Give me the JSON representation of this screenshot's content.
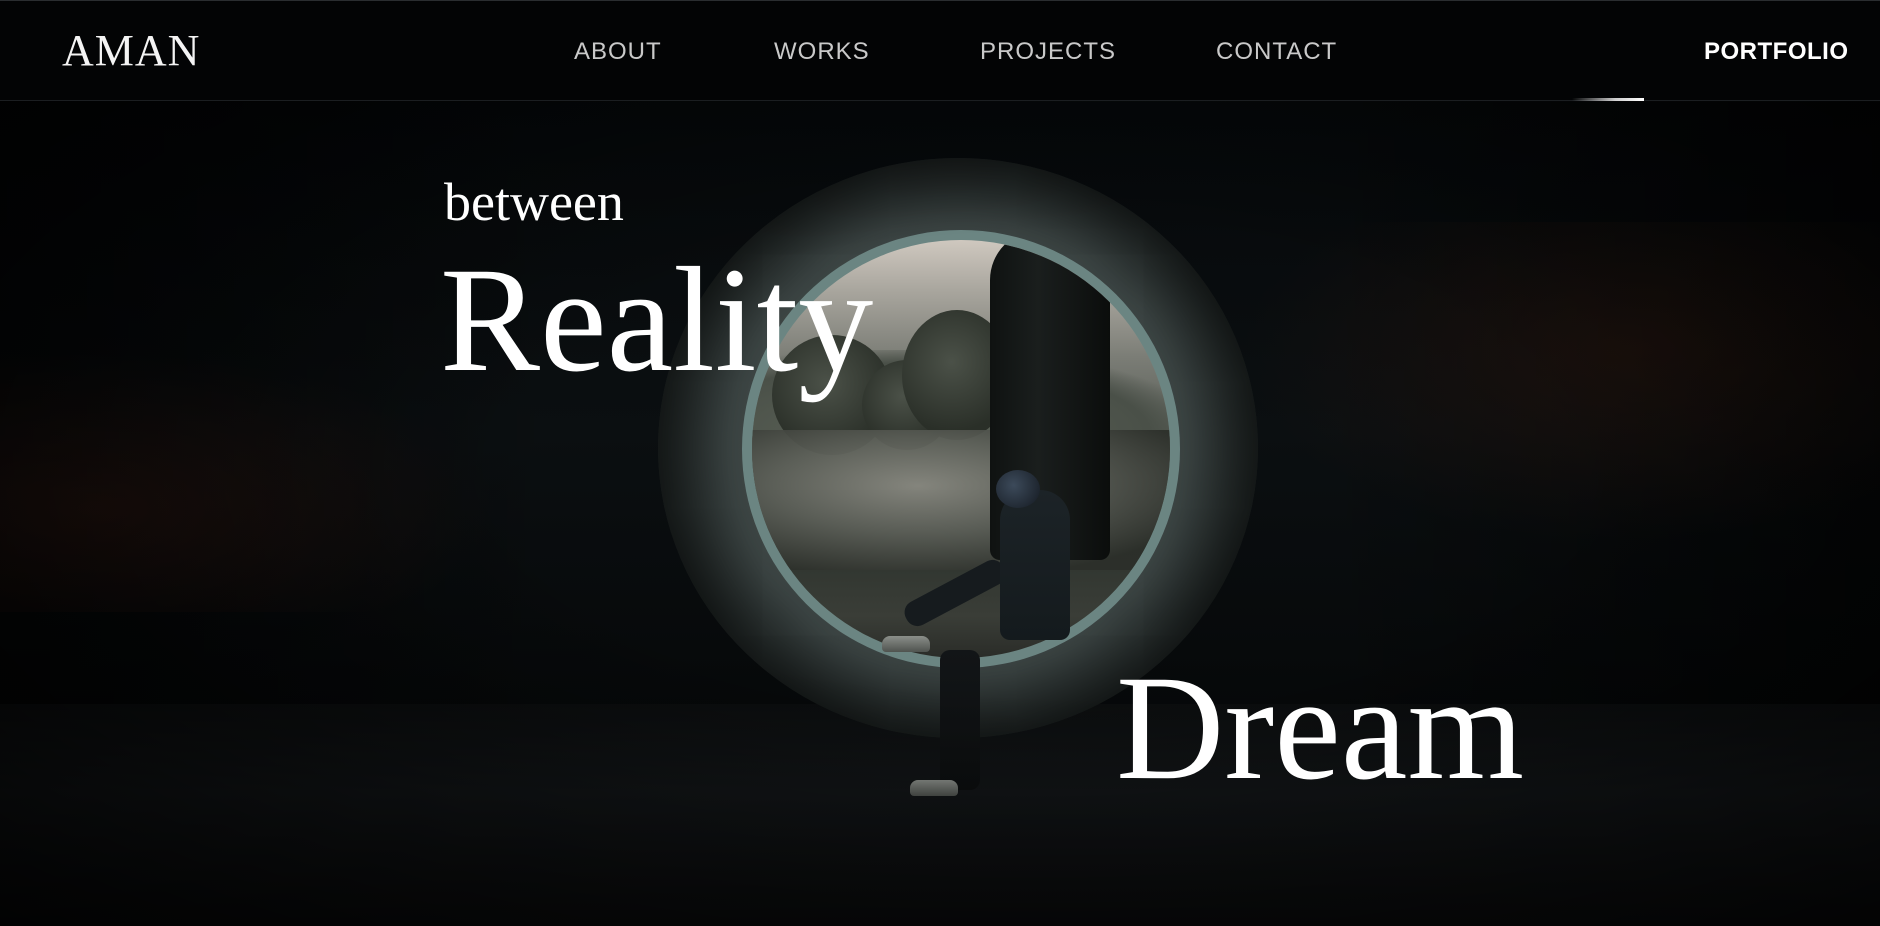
{
  "header": {
    "logo": "AMAN",
    "nav": [
      {
        "label": "ABOUT"
      },
      {
        "label": "WORKS"
      },
      {
        "label": "PROJECTS"
      },
      {
        "label": "CONTACT"
      }
    ],
    "portfolio_label": "PORTFOLIO"
  },
  "hero": {
    "line_small": "between",
    "line_large_1": "Reality",
    "line_large_2": "Dream",
    "image_subject": "person sitting in a large concrete ring with a standing figure, landscape visible through the circle"
  },
  "colors": {
    "background": "#000000",
    "header_bg": "#030405",
    "text_primary": "#ffffff",
    "nav_text": "#c9c9c9"
  }
}
